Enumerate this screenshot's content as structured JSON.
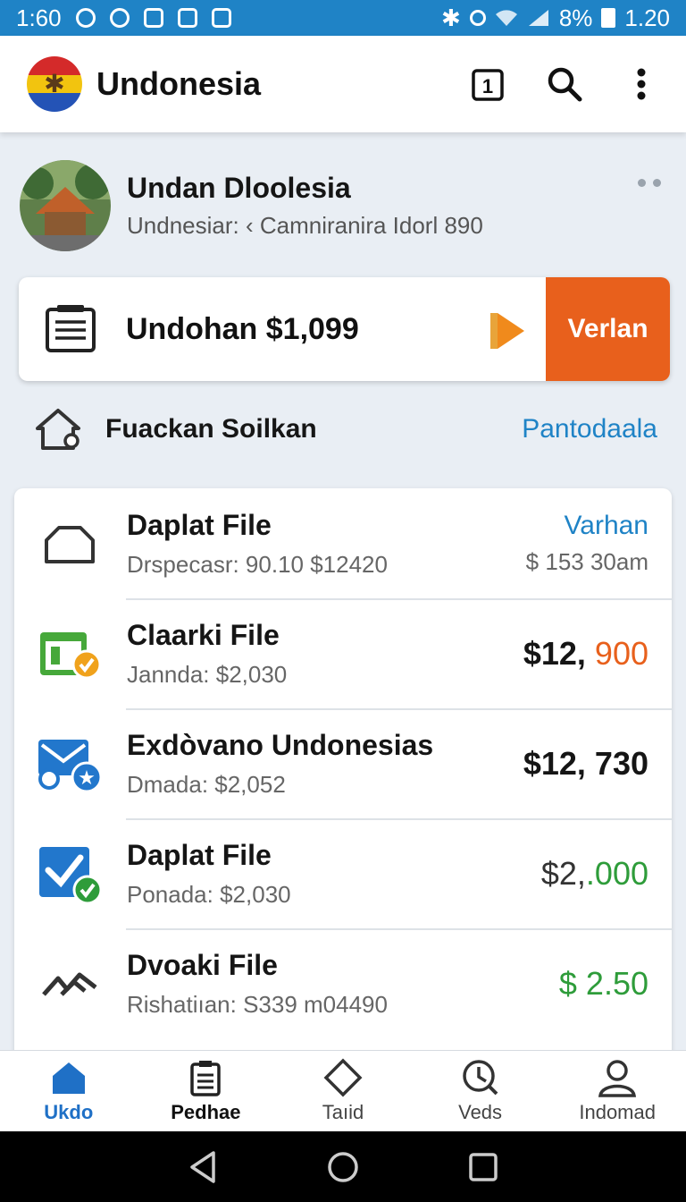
{
  "status_bar": {
    "time": "1:60",
    "battery": "8%",
    "clock_right": "1.20",
    "left_icons": [
      "settings-icon",
      "shield-icon",
      "message-icon",
      "app-icon",
      "calendar-icon"
    ],
    "right_icons": [
      "bluetooth-icon",
      "alarm-icon",
      "wifi-icon",
      "signal-icon",
      "battery-icon"
    ]
  },
  "app_bar": {
    "title": "Undonesia",
    "tab_count": "1",
    "actions": [
      "tabs-icon",
      "search-icon",
      "more-vert-icon"
    ]
  },
  "profile": {
    "name": "Undan Dloolesia",
    "subtitle": "Undnesiar: ‹ Camniranira Idorl 890"
  },
  "promo": {
    "text": "Undohan $1,099",
    "cta_label": "Verlan"
  },
  "section": {
    "title": "Fuackan Soilkan",
    "link": "Pantodaala"
  },
  "list": [
    {
      "icon": "folder-icon",
      "title": "Daplat File",
      "subtitle": "Drspecasr: 90.10 $12420",
      "amount": "Varhan",
      "amount_sub": "$ 153 30am"
    },
    {
      "icon": "calendar-check-icon",
      "title": "Claarki File",
      "subtitle": "Jannda: $2,030",
      "amount_a": "$12, ",
      "amount_b": "900"
    },
    {
      "icon": "mail-star-icon",
      "title": "Exdòvano Undonesias",
      "subtitle": "Dmada: $2,052",
      "amount": "$12, 730"
    },
    {
      "icon": "checkbox-icon",
      "title": "Daplat File",
      "subtitle": "Ponada: $2,030",
      "amount_a": "$2,",
      "amount_b": ".000"
    },
    {
      "icon": "trend-icon",
      "title": "Dvoaki File",
      "subtitle": "Rishatiıan: S339 m04490",
      "amount": "$ 2.50"
    }
  ],
  "bottom_nav": [
    {
      "icon": "home-icon",
      "label": "Ukdo"
    },
    {
      "icon": "clipboard-icon",
      "label": "Pedhae"
    },
    {
      "icon": "diamond-icon",
      "label": "Taıid"
    },
    {
      "icon": "clock-icon",
      "label": "Veds"
    },
    {
      "icon": "person-icon",
      "label": "Indomad"
    }
  ],
  "colors": {
    "primary": "#1f83c6",
    "cta": "#e8601c",
    "orange_amount": "#e8601c",
    "green_amount": "#2e9c3a"
  }
}
